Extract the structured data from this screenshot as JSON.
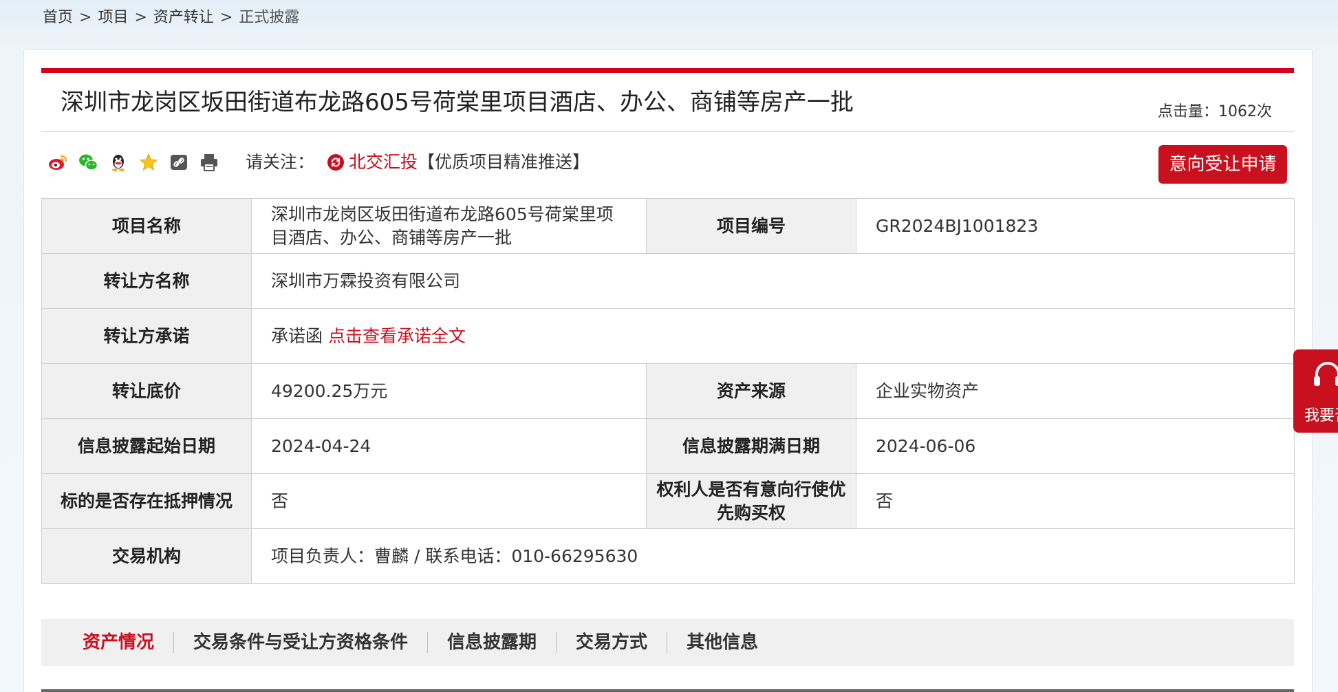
{
  "breadcrumb": {
    "home": "首页",
    "project": "项目",
    "asset_transfer": "资产转让",
    "current": "正式披露",
    "separator": ">"
  },
  "title": "深圳市龙岗区坂田街道布龙路605号荷棠里项目酒店、办公、商铺等房产一批",
  "clicks": "点击量：1062次",
  "share_icons": [
    "weibo-icon",
    "wechat-icon",
    "qq-icon",
    "favorite-star-icon",
    "copy-link-icon",
    "print-icon"
  ],
  "attention": {
    "label": "请关注：",
    "brand": "北交汇投",
    "promo": "【优质项目精准推送】"
  },
  "apply_button": "意向受让申请",
  "info": {
    "project_name_label": "项目名称",
    "project_name": "深圳市龙岗区坂田街道布龙路605号荷棠里项目酒店、办公、商铺等房产一批",
    "project_no_label": "项目编号",
    "project_no": "GR2024BJ1001823",
    "transferor_label": "转让方名称",
    "transferor": "深圳市万霖投资有限公司",
    "commitment_label": "转让方承诺",
    "commitment_text": "承诺函",
    "commitment_link": "点击查看承诺全文",
    "price_label": "转让底价",
    "price": "49200.25万元",
    "source_label": "资产来源",
    "source": "企业实物资产",
    "start_label": "信息披露起始日期",
    "start_date": "2024-04-24",
    "end_label": "信息披露期满日期",
    "end_date": "2024-06-06",
    "mortgage_label": "标的是否存在抵押情况",
    "mortgage": "否",
    "priority_label": "权利人是否有意向行使优先购买权",
    "priority": "否",
    "agency_label": "交易机构",
    "agency": "项目负责人：曹麟 / 联系电话：010-66295630"
  },
  "side_widget": {
    "text": "我要咨询",
    "icon": "headset-icon"
  },
  "tabs": [
    "资产情况",
    "交易条件与受让方资格条件",
    "信息披露期",
    "交易方式",
    "其他信息"
  ],
  "colors": {
    "accent": "#c8101f",
    "top_bar": "#d6001c",
    "label_bg": "#f0f0f0"
  }
}
